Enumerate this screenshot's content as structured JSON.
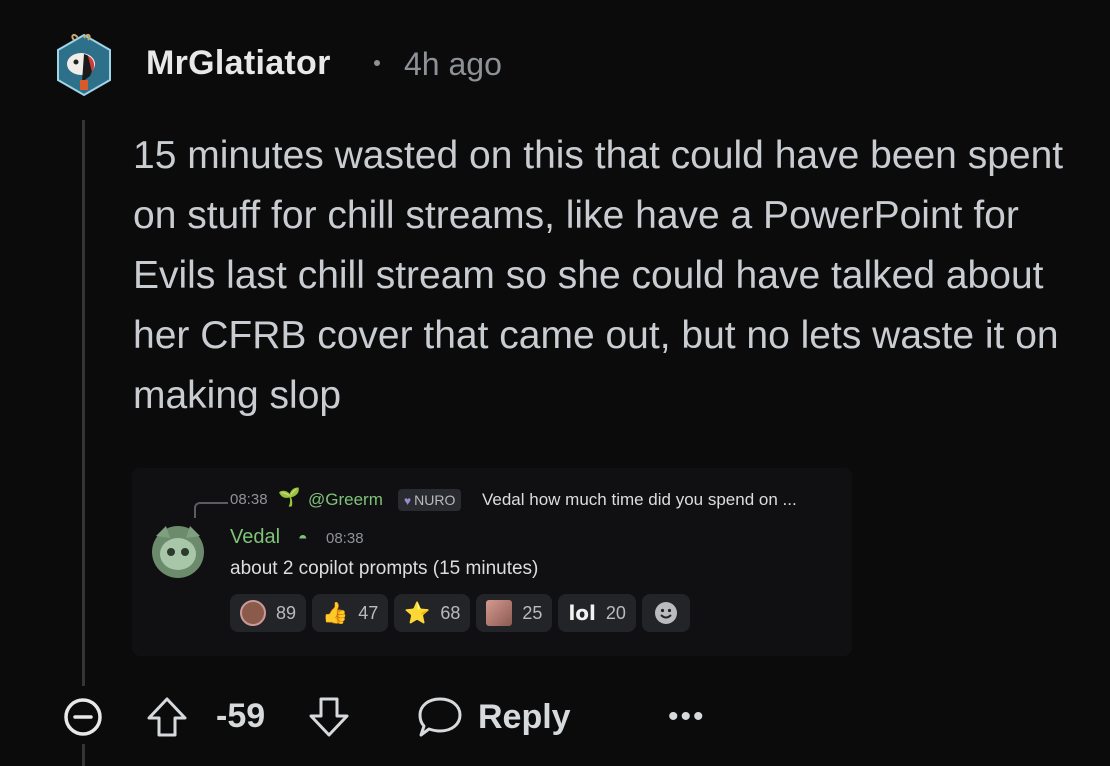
{
  "comment": {
    "username": "MrGlatiator",
    "timestamp": "4h ago",
    "body": "15 minutes wasted on this that could have been spent on stuff for chill streams, like have a PowerPoint for Evils last chill stream so she could have talked about her CFRB cover that came out, but no lets waste it on making slop"
  },
  "embed": {
    "reply_preview": {
      "time": "08:38",
      "mention": "@Greerm",
      "tag": "NURO",
      "message": "Vedal how much time did you spend on ..."
    },
    "message": {
      "author": "Vedal",
      "time": "08:38",
      "text": "about 2 copilot prompts (15 minutes)"
    },
    "reactions": [
      {
        "icon": "round-avatar-emoji",
        "count": "89"
      },
      {
        "icon": "thumbs-up-emoji",
        "glyph": "👍",
        "count": "47"
      },
      {
        "icon": "star-emoji",
        "glyph": "⭐",
        "count": "68"
      },
      {
        "icon": "image-emoji",
        "count": "25"
      },
      {
        "icon": "lol-emoji",
        "glyph": "lol",
        "count": "20"
      }
    ]
  },
  "actions": {
    "score": "-59",
    "reply_label": "Reply",
    "more_label": "•••"
  }
}
